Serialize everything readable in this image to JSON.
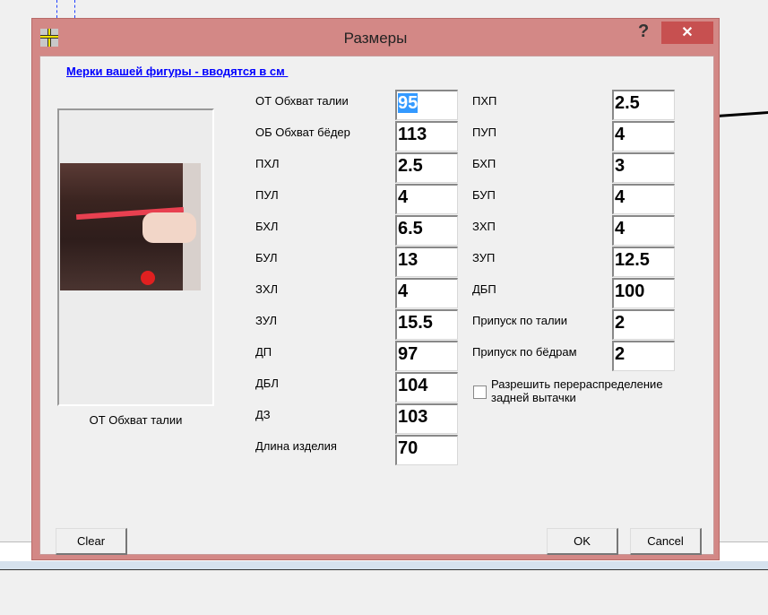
{
  "dialog": {
    "title": "Размеры",
    "help_label": "?",
    "close_label": "✕",
    "heading": "Мерки вашей фигуры - вводятся в см ",
    "photo_caption": "ОТ Обхват талии",
    "left_fields": [
      {
        "label": "ОТ Обхват талии",
        "value": "95",
        "selected": true
      },
      {
        "label": "ОБ Обхват бёдер",
        "value": "113"
      },
      {
        "label": "ПХЛ",
        "value": "2.5"
      },
      {
        "label": "ПУЛ",
        "value": "4"
      },
      {
        "label": "БХЛ",
        "value": "6.5"
      },
      {
        "label": "БУЛ",
        "value": "13"
      },
      {
        "label": "ЗХЛ",
        "value": "4"
      },
      {
        "label": "ЗУЛ",
        "value": "15.5"
      },
      {
        "label": "ДП",
        "value": "97"
      },
      {
        "label": "ДБЛ",
        "value": "104"
      },
      {
        "label": "ДЗ",
        "value": "103"
      },
      {
        "label": "Длина изделия",
        "value": "70"
      }
    ],
    "right_fields": [
      {
        "label": "ПХП",
        "value": "2.5"
      },
      {
        "label": "ПУП",
        "value": "4"
      },
      {
        "label": "БХП",
        "value": "3"
      },
      {
        "label": "БУП",
        "value": "4"
      },
      {
        "label": "ЗХП",
        "value": "4"
      },
      {
        "label": "ЗУП",
        "value": "12.5"
      },
      {
        "label": "ДБП",
        "value": "100"
      },
      {
        "label": "Припуск по талии",
        "value": "2"
      },
      {
        "label": "Припуск по бёдрам",
        "value": "2"
      }
    ],
    "checkbox": {
      "label": "Разрешить перераспределение задней вытачки",
      "checked": false
    },
    "buttons": {
      "clear": "Clear",
      "ok": "OK",
      "cancel": "Cancel"
    }
  }
}
